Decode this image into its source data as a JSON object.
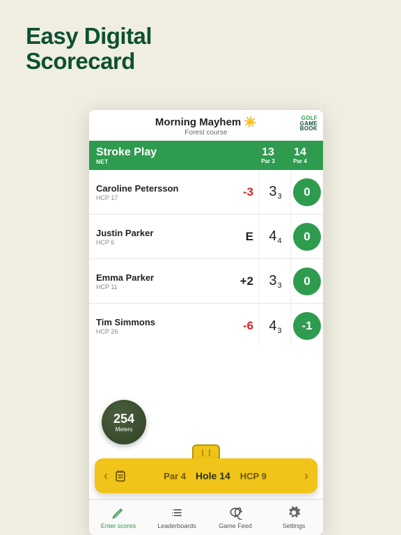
{
  "heading_line1": "Easy Digital",
  "heading_line2": "Scorecard",
  "brand": {
    "l1": "GOLF",
    "l2": "GAME",
    "l3": "BOOK"
  },
  "session": {
    "title": "Morning Mayhem ☀️",
    "subtitle": "Forest course"
  },
  "mode": {
    "title": "Stroke Play",
    "subtitle": "NET"
  },
  "holes": [
    {
      "num": "13",
      "par": "Par 3"
    },
    {
      "num": "14",
      "par": "Par 4"
    }
  ],
  "players": [
    {
      "name": "Caroline Petersson",
      "hcp": "HCP 17",
      "net": "-3",
      "net_neg": true,
      "stroke": "3",
      "stroke_sub": "3",
      "badge": "0"
    },
    {
      "name": "Justin Parker",
      "hcp": "HCP 6",
      "net": "E",
      "net_neg": false,
      "stroke": "4",
      "stroke_sub": "4",
      "badge": "0"
    },
    {
      "name": "Emma Parker",
      "hcp": "HCP 11",
      "net": "+2",
      "net_neg": false,
      "stroke": "3",
      "stroke_sub": "3",
      "badge": "0"
    },
    {
      "name": "Tim Simmons",
      "hcp": "HCP 26",
      "net": "-6",
      "net_neg": true,
      "stroke": "4",
      "stroke_sub": "3",
      "badge": "-1"
    }
  ],
  "distance": {
    "value": "254",
    "unit": "Meters"
  },
  "gold": {
    "par": "Par 4",
    "hole": "Hole 14",
    "hcp": "HCP 9"
  },
  "tabs": [
    {
      "label": "Enter scores"
    },
    {
      "label": "Leaderboards"
    },
    {
      "label": "Game Feed"
    },
    {
      "label": "Settings"
    }
  ]
}
